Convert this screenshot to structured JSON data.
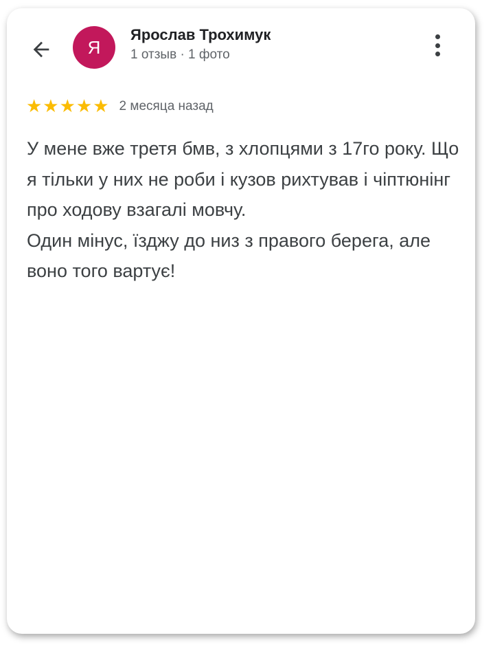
{
  "header": {
    "back_icon": "arrow-left-icon",
    "more_icon": "more-vert-icon"
  },
  "author": {
    "initial": "Я",
    "name": "Ярослав Трохимук",
    "meta": "1 отзыв · 1 фото",
    "avatar_color": "#c2185b"
  },
  "review": {
    "rating": 5,
    "rating_max": 5,
    "stars": "★★★★★",
    "star_color": "#fbbc04",
    "date": "2 месяца назад",
    "text": "У мене вже третя бмв, з хлопцями з 17го року. Що я тільки у них не роби і кузов рихтував і чіптюнінг про ходову взагалі мовчу.\nОдин мінус, їзджу до низ з правого берега, але воно того вартує!"
  }
}
